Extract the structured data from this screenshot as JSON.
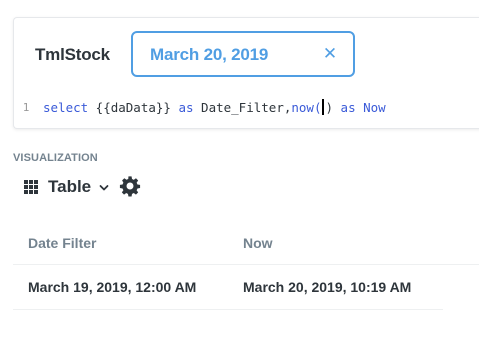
{
  "parameter": {
    "label": "TmlStock",
    "value": "March 20, 2019"
  },
  "editor": {
    "line_number": "1",
    "code": {
      "t1": "select",
      "t2": " {{daData}} ",
      "t3": "as",
      "t4": " Date_Filter,",
      "t5": "now(",
      "t6": ")",
      "t7": " as",
      "t8": " Now"
    }
  },
  "visualization": {
    "section_label": "VISUALIZATION",
    "type_label": "Table"
  },
  "table": {
    "columns": [
      "Date Filter",
      "Now"
    ],
    "rows": [
      [
        "March 19, 2019, 12:00 AM",
        "March 20, 2019, 10:19 AM"
      ]
    ]
  },
  "icons": {
    "clear": "close-icon",
    "grid": "table-grid-icon",
    "chevron": "chevron-down-icon",
    "gear": "gear-icon"
  },
  "colors": {
    "accent": "#509ee3",
    "text_dark": "#2e353b",
    "text_muted": "#74838f",
    "keyword": "#3a5ad8"
  }
}
